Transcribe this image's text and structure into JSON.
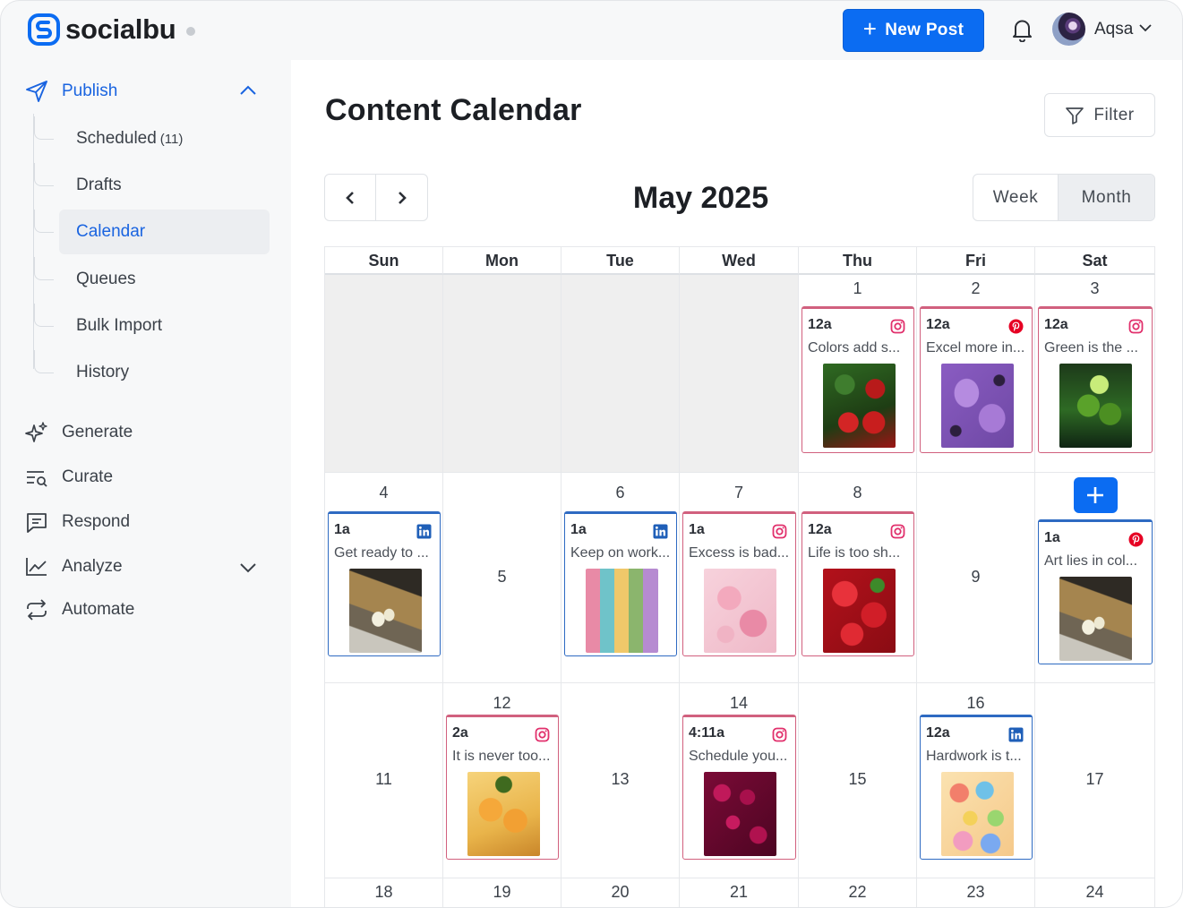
{
  "app": {
    "name": "socialbu"
  },
  "topbar": {
    "new_post_label": "New Post",
    "user_name": "Aqsa"
  },
  "sidebar": {
    "publish": {
      "label": "Publish",
      "items": [
        {
          "label": "Scheduled",
          "count": "(11)"
        },
        {
          "label": "Drafts"
        },
        {
          "label": "Calendar"
        },
        {
          "label": "Queues"
        },
        {
          "label": "Bulk Import"
        },
        {
          "label": "History"
        }
      ]
    },
    "generate": "Generate",
    "curate": "Curate",
    "respond": "Respond",
    "analyze": "Analyze",
    "automate": "Automate"
  },
  "main": {
    "title": "Content Calendar",
    "filter_label": "Filter",
    "month_label": "May 2025",
    "week_label": "Week",
    "month_view_label": "Month"
  },
  "calendar": {
    "day_headers": [
      "Sun",
      "Mon",
      "Tue",
      "Wed",
      "Thu",
      "Fri",
      "Sat"
    ],
    "weeks": [
      [
        {
          "day": "",
          "off": true
        },
        {
          "day": "",
          "off": true
        },
        {
          "day": "",
          "off": true
        },
        {
          "day": "",
          "off": true
        },
        {
          "day": "1",
          "post": {
            "time": "12a",
            "network": "instagram",
            "text": "Colors add s...",
            "image": "strawberries-mint"
          }
        },
        {
          "day": "2",
          "post": {
            "time": "12a",
            "network": "pinterest",
            "text": "Excel more in...",
            "image": "purple-popsicles"
          }
        },
        {
          "day": "3",
          "post": {
            "time": "12a",
            "network": "instagram",
            "text": "Green is the ...",
            "image": "limes"
          }
        }
      ],
      [
        {
          "day": "4",
          "post": {
            "time": "1a",
            "network": "linkedin",
            "text": "Get ready to ...",
            "image": "tulips-on-sand"
          }
        },
        {
          "day": "5"
        },
        {
          "day": "6",
          "post": {
            "time": "1a",
            "network": "linkedin",
            "text": "Keep on work...",
            "image": "color-blocks"
          }
        },
        {
          "day": "7",
          "post": {
            "time": "1a",
            "network": "instagram",
            "text": "Excess is bad...",
            "image": "pink-strawberries"
          }
        },
        {
          "day": "8",
          "post": {
            "time": "12a",
            "network": "instagram",
            "text": "Life is too sh...",
            "image": "red-strawberries"
          }
        },
        {
          "day": "9"
        },
        {
          "day": "",
          "post": {
            "time": "1a",
            "network": "pinterest",
            "text": "Art lies in col...",
            "image": "tulips-on-sand"
          },
          "add": true
        }
      ],
      [
        {
          "day": "11"
        },
        {
          "day": "12",
          "post": {
            "time": "2a",
            "network": "instagram",
            "text": "It is never too...",
            "image": "oranges-pineapple"
          }
        },
        {
          "day": "13"
        },
        {
          "day": "14",
          "post": {
            "time": "4:11a",
            "network": "instagram",
            "text": "Schedule you...",
            "image": "raspberries"
          }
        },
        {
          "day": "15"
        },
        {
          "day": "16",
          "post": {
            "time": "12a",
            "network": "linkedin",
            "text": "Hardwork is t...",
            "image": "candy-faces"
          }
        },
        {
          "day": "17"
        }
      ],
      [
        {
          "day": "18"
        },
        {
          "day": "19"
        },
        {
          "day": "20"
        },
        {
          "day": "21"
        },
        {
          "day": "22"
        },
        {
          "day": "23"
        },
        {
          "day": "24"
        }
      ]
    ]
  },
  "colors": {
    "primary": "#0b6cf2",
    "instagram_border": "#d1607e",
    "linkedin_border": "#2e6ac2",
    "pinterest": "#e60023"
  }
}
